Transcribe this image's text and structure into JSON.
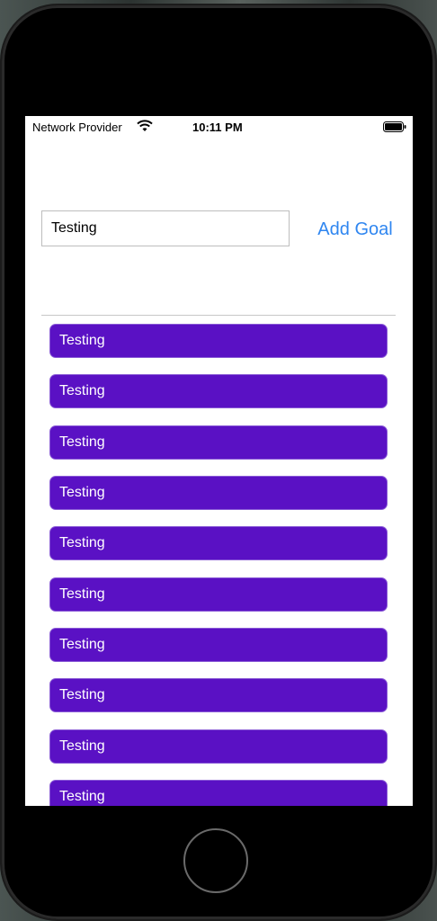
{
  "status_bar": {
    "carrier": "Network Provider",
    "time": "10:11 PM",
    "wifi_icon": "wifi-icon",
    "battery_icon": "battery-icon"
  },
  "form": {
    "input_value": "Testing",
    "add_button_label": "Add Goal"
  },
  "goals": [
    "Testing",
    "Testing",
    "Testing",
    "Testing",
    "Testing",
    "Testing",
    "Testing",
    "Testing",
    "Testing",
    "Testing"
  ],
  "colors": {
    "accent": "#2f86f0",
    "goal_item_bg": "#5a11c4",
    "goal_item_text": "#ffffff"
  }
}
